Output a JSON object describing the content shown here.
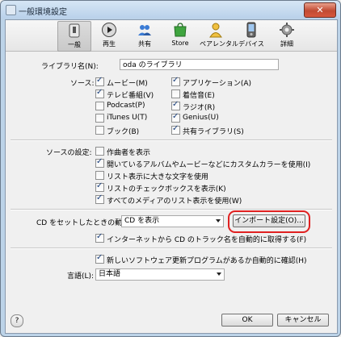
{
  "window": {
    "title": "一般環境設定",
    "close_glyph": "✕"
  },
  "toolbar": {
    "items": [
      {
        "label": "一般",
        "icon": "general-icon"
      },
      {
        "label": "再生",
        "icon": "playback-icon"
      },
      {
        "label": "共有",
        "icon": "sharing-icon"
      },
      {
        "label": "Store",
        "icon": "store-icon"
      },
      {
        "label": "ペアレンタル",
        "icon": "parental-icon"
      },
      {
        "label": "デバイス",
        "icon": "devices-icon"
      },
      {
        "label": "詳細",
        "icon": "advanced-icon"
      }
    ]
  },
  "library": {
    "label": "ライブラリ名(N):",
    "value": "oda のライブラリ"
  },
  "sources": {
    "label": "ソース:",
    "left": [
      {
        "label": "ムービー(M)",
        "checked": true
      },
      {
        "label": "テレビ番組(V)",
        "checked": true
      },
      {
        "label": "Podcast(P)",
        "checked": false
      },
      {
        "label": "iTunes U(T)",
        "checked": false
      },
      {
        "label": "ブック(B)",
        "checked": false
      }
    ],
    "right": [
      {
        "label": "アプリケーション(A)",
        "checked": true
      },
      {
        "label": "着信音(E)",
        "checked": false
      },
      {
        "label": "ラジオ(R)",
        "checked": true
      },
      {
        "label": "Genius(U)",
        "checked": true
      },
      {
        "label": "共有ライブラリ(S)",
        "checked": true
      }
    ]
  },
  "source_settings": {
    "label": "ソースの設定:",
    "options": [
      {
        "label": "作曲者を表示",
        "checked": false
      },
      {
        "label": "開いているアルバムやムービーなどにカスタムカラーを使用(I)",
        "checked": true
      },
      {
        "label": "リスト表示に大きな文字を使用",
        "checked": false
      },
      {
        "label": "リストのチェックボックスを表示(K)",
        "checked": true
      },
      {
        "label": "すべてのメディアのリスト表示を使用(W)",
        "checked": true
      }
    ]
  },
  "cd": {
    "label": "CD をセットしたときの動作(C):",
    "select_value": "CD を表示",
    "import_button": "インポート設定(O)...",
    "track_names": {
      "label": "インターネットから CD のトラック名を自動的に取得する(F)",
      "checked": true
    }
  },
  "updates": {
    "label": "新しいソフトウェア更新プログラムがあるか自動的に確認(H)",
    "checked": true
  },
  "language": {
    "label": "言語(L):",
    "value": "日本語"
  },
  "footer": {
    "help": "?",
    "ok": "OK",
    "cancel": "キャンセル"
  }
}
